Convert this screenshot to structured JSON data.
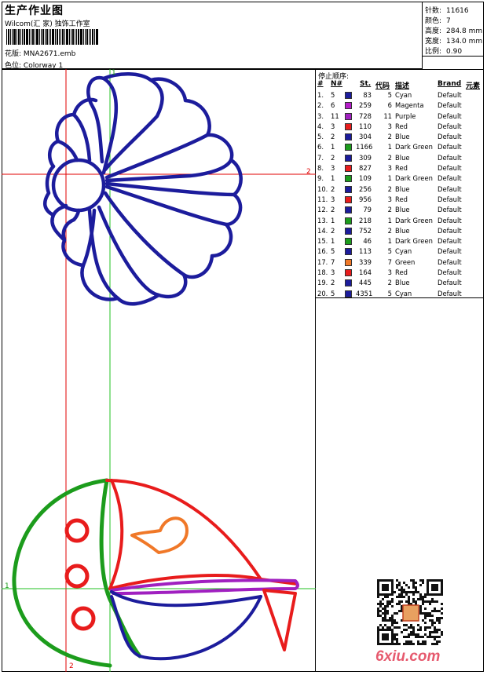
{
  "header": {
    "title": "生产作业图",
    "subtitle": "Wilcom(汇 家) 独饰工作室",
    "design_label": "花版:",
    "design_value": "MNA2671.emb",
    "colorway_label": "色位:",
    "colorway_value": "Colorway 1"
  },
  "stats": [
    {
      "label": "针数:",
      "value": "11616"
    },
    {
      "label": "颜色:",
      "value": "7"
    },
    {
      "label": "高度:",
      "value": "284.8 mm"
    },
    {
      "label": "宽度:",
      "value": "134.0 mm"
    },
    {
      "label": "比例:",
      "value": "0.90"
    }
  ],
  "stop_sequence": {
    "title": "停止顺序:",
    "headers": {
      "idx": "#",
      "n": "N#",
      "st": "St.",
      "code": "代码",
      "desc": "描述",
      "brand": "Brand",
      "elem": "元素"
    },
    "rows": [
      {
        "idx": "1.",
        "n": "5",
        "color": "#1c1c9c",
        "st": "83",
        "code": "5",
        "desc": "Cyan",
        "brand": "Default"
      },
      {
        "idx": "2.",
        "n": "6",
        "color": "#b41cc8",
        "st": "259",
        "code": "6",
        "desc": "Magenta",
        "brand": "Default"
      },
      {
        "idx": "3.",
        "n": "11",
        "color": "#a020c0",
        "st": "728",
        "code": "11",
        "desc": "Purple",
        "brand": "Default"
      },
      {
        "idx": "4.",
        "n": "3",
        "color": "#e81c1c",
        "st": "110",
        "code": "3",
        "desc": "Red",
        "brand": "Default"
      },
      {
        "idx": "5.",
        "n": "2",
        "color": "#1c1c9c",
        "st": "304",
        "code": "2",
        "desc": "Blue",
        "brand": "Default"
      },
      {
        "idx": "6.",
        "n": "1",
        "color": "#1c9c1c",
        "st": "1166",
        "code": "1",
        "desc": "Dark Green",
        "brand": "Default"
      },
      {
        "idx": "7.",
        "n": "2",
        "color": "#1c1c9c",
        "st": "309",
        "code": "2",
        "desc": "Blue",
        "brand": "Default"
      },
      {
        "idx": "8.",
        "n": "3",
        "color": "#e81c1c",
        "st": "827",
        "code": "3",
        "desc": "Red",
        "brand": "Default"
      },
      {
        "idx": "9.",
        "n": "1",
        "color": "#1c9c1c",
        "st": "109",
        "code": "1",
        "desc": "Dark Green",
        "brand": "Default"
      },
      {
        "idx": "10.",
        "n": "2",
        "color": "#1c1c9c",
        "st": "256",
        "code": "2",
        "desc": "Blue",
        "brand": "Default"
      },
      {
        "idx": "11.",
        "n": "3",
        "color": "#e81c1c",
        "st": "956",
        "code": "3",
        "desc": "Red",
        "brand": "Default"
      },
      {
        "idx": "12.",
        "n": "2",
        "color": "#1c1c9c",
        "st": "79",
        "code": "2",
        "desc": "Blue",
        "brand": "Default"
      },
      {
        "idx": "13.",
        "n": "1",
        "color": "#1c9c1c",
        "st": "218",
        "code": "1",
        "desc": "Dark Green",
        "brand": "Default"
      },
      {
        "idx": "14.",
        "n": "2",
        "color": "#1c1c9c",
        "st": "752",
        "code": "2",
        "desc": "Blue",
        "brand": "Default"
      },
      {
        "idx": "15.",
        "n": "1",
        "color": "#1c9c1c",
        "st": "46",
        "code": "1",
        "desc": "Dark Green",
        "brand": "Default"
      },
      {
        "idx": "16.",
        "n": "5",
        "color": "#1c1c9c",
        "st": "113",
        "code": "5",
        "desc": "Cyan",
        "brand": "Default"
      },
      {
        "idx": "17.",
        "n": "7",
        "color": "#f07828",
        "st": "339",
        "code": "7",
        "desc": "Green",
        "brand": "Default"
      },
      {
        "idx": "18.",
        "n": "3",
        "color": "#e81c1c",
        "st": "164",
        "code": "3",
        "desc": "Red",
        "brand": "Default"
      },
      {
        "idx": "19.",
        "n": "2",
        "color": "#1c1c9c",
        "st": "445",
        "code": "2",
        "desc": "Blue",
        "brand": "Default"
      },
      {
        "idx": "20.",
        "n": "5",
        "color": "#1c1c9c",
        "st": "4351",
        "code": "5",
        "desc": "Cyan",
        "brand": "Default"
      }
    ]
  },
  "guides": {
    "label_1": "1",
    "label_2": "2"
  },
  "watermark": "6xiu.com",
  "colors": {
    "blue": "#1c1c9c",
    "red": "#e81c1c",
    "green": "#1c9c1c",
    "purple": "#a020c0",
    "orange": "#f07828",
    "guide_red": "#e00000",
    "guide_green": "#22c022"
  }
}
